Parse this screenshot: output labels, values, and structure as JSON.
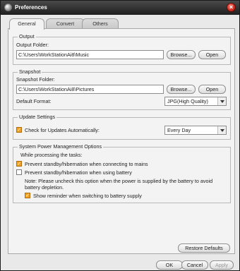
{
  "window": {
    "title": "Preferences"
  },
  "tabs": [
    {
      "label": "General",
      "active": true
    },
    {
      "label": "Convert",
      "active": false
    },
    {
      "label": "Others",
      "active": false
    }
  ],
  "output": {
    "group_title": "Output",
    "folder_label": "Output Folder:",
    "folder_value": "C:\\Users\\WorkStationAi8\\Music",
    "browse_label": "Browse...",
    "open_label": "Open"
  },
  "snapshot": {
    "group_title": "Snapshot",
    "folder_label": "Snapshot Folder:",
    "folder_value": "C:\\Users\\WorkStationAi8\\Pictures",
    "browse_label": "Browse...",
    "open_label": "Open",
    "format_label": "Default Format:",
    "format_value": "JPG(High Quality)"
  },
  "updates": {
    "group_title": "Update Settings",
    "check_label": "Check for Updates Automatically:",
    "check_checked": true,
    "frequency_value": "Every Day"
  },
  "power": {
    "group_title": "System Power Management Options",
    "intro": "While processing the tasks:",
    "mains_label": "Prevent standby/hibernation when connecting to mains",
    "mains_checked": true,
    "battery_label": "Prevent standby/hibernation when using battery",
    "battery_checked": false,
    "note_line1": "Note: Please uncheck this option when the power is supplied by the battery to avoid",
    "note_line2": "battery depletion.",
    "reminder_label": "Show reminder when switching to battery supply",
    "reminder_checked": true
  },
  "restore_label": "Restore Defaults",
  "footer": {
    "ok_label": "OK",
    "cancel_label": "Cancel",
    "apply_label": "Apply"
  },
  "colors": {
    "accent_check": "#f0a020",
    "close_button": "#c8251a",
    "titlebar": "#2a2a2a"
  }
}
